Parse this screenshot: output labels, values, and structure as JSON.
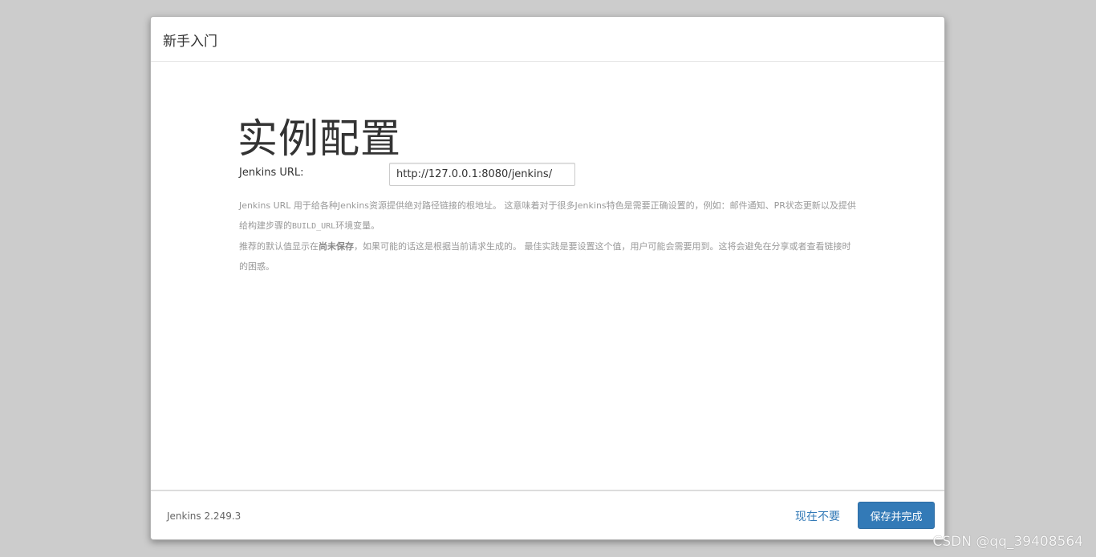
{
  "modal": {
    "title": "新手入门"
  },
  "main": {
    "heading": "实例配置",
    "url_label": "Jenkins URL:",
    "url_value": "http://127.0.0.1:8080/jenkins/",
    "help1_a": "Jenkins URL 用于给各种Jenkins资源提供绝对路径链接的根地址。 这意味着对于很多Jenkins特色是需要正确设置的，例如：邮件通知、PR状态更新以及提供给构建步骤的",
    "help1_code": "BUILD_URL",
    "help1_b": "环境变量。",
    "help2_a": "推荐的默认值显示在",
    "help2_strong": "尚未保存",
    "help2_b": "，如果可能的话这是根据当前请求生成的。 最佳实践是要设置这个值，用户可能会需要用到。这将会避免在分享或者查看链接时的困惑。"
  },
  "footer": {
    "version": "Jenkins 2.249.3",
    "skip_label": "现在不要",
    "save_label": "保存并完成"
  },
  "watermark": "CSDN @qq_39408564",
  "colors": {
    "backdrop": "#cccccc",
    "primary": "#337ab7",
    "help_text": "#999999"
  }
}
